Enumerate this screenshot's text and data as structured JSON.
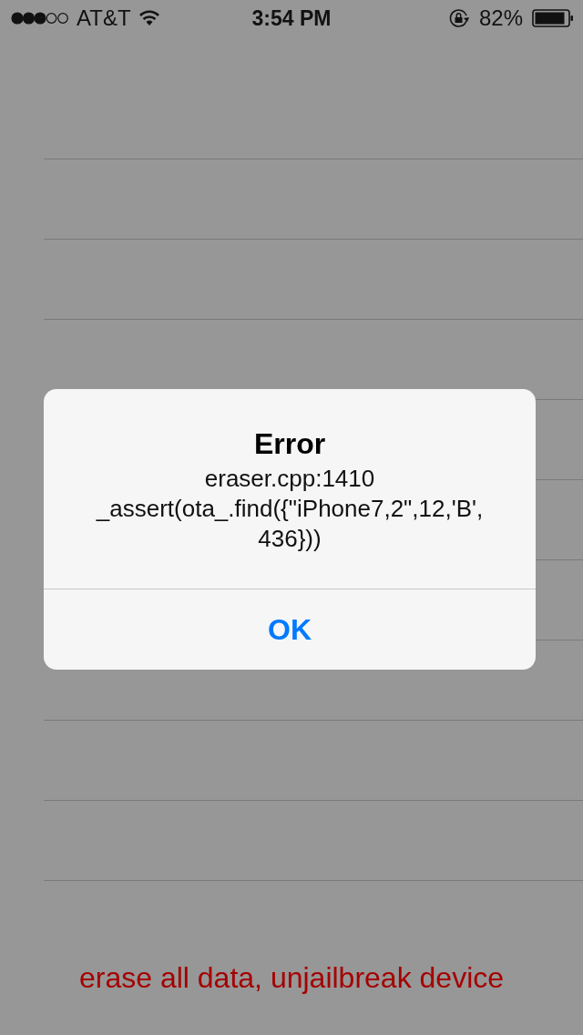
{
  "status_bar": {
    "carrier": "AT&T",
    "time": "3:54 PM",
    "battery_percent": "82%"
  },
  "alert": {
    "title": "Error",
    "message": "eraser.cpp:1410\n_assert(ota_.find({\"iPhone7,2\",12,'B',\n436}))",
    "buttons": [
      "OK"
    ]
  },
  "footer_link": "erase all data, unjailbreak device"
}
